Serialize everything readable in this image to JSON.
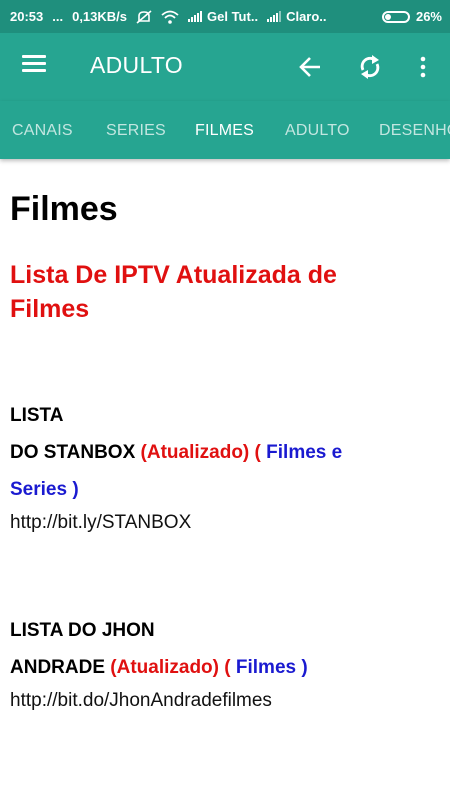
{
  "status": {
    "time": "20:53",
    "dots": "...",
    "speed": "0,13KB/s",
    "carrier1": "Gel Tut..",
    "carrier2": "Claro..",
    "battery": "26%"
  },
  "appbar": {
    "title": "ADULTO",
    "icons": [
      "menu-icon",
      "arrow-left-icon",
      "refresh-icon",
      "more-vert-icon"
    ]
  },
  "tabs": [
    {
      "label": "CANAIS"
    },
    {
      "label": "SERIES"
    },
    {
      "label": "FILMES"
    },
    {
      "label": "ADULTO"
    },
    {
      "label": "DESENHOS"
    }
  ],
  "active_tab": "FILMES",
  "content": {
    "heading": "Filmes",
    "subtitle": "Lista De IPTV Atualizada de Filmes",
    "entries": [
      {
        "line1": "LISTA",
        "line2_black": "DO STANBOX",
        "updated": "(Atualizado)",
        "paren_open": "(",
        "category_a": "Filmes e",
        "category_b": "Series )",
        "url": "http://bit.ly/STANBOX"
      },
      {
        "line1": "LISTA DO JHON",
        "line2_black": "ANDRADE",
        "updated": "(Atualizado)",
        "paren_open": "(",
        "category": "Filmes )",
        "url": "http://bit.do/JhonAndradefilmes"
      }
    ]
  },
  "colors": {
    "status_bar": "#1f8f7d",
    "app_bar": "#26a591",
    "accent_red": "#e01010",
    "accent_blue": "#1a1ad0"
  }
}
